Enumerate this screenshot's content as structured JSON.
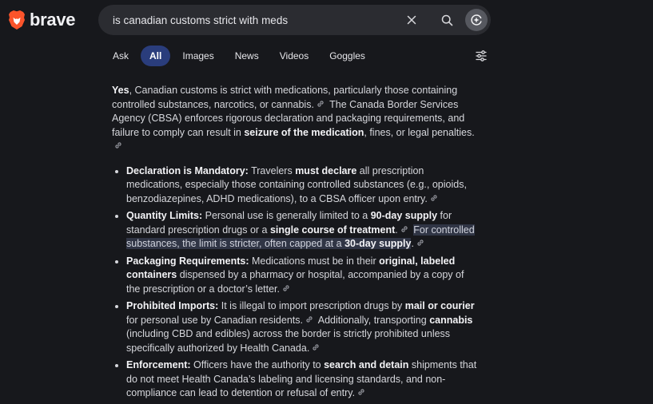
{
  "brand": {
    "name": "brave",
    "logo_color": "#fb542b"
  },
  "search": {
    "query": "is canadian customs strict with meds"
  },
  "tabs": [
    {
      "label": "Ask",
      "active": false
    },
    {
      "label": "All",
      "active": true
    },
    {
      "label": "Images",
      "active": false
    },
    {
      "label": "News",
      "active": false
    },
    {
      "label": "Videos",
      "active": false
    },
    {
      "label": "Goggles",
      "active": false
    }
  ],
  "answer": {
    "intro": {
      "lead": "Yes",
      "t1": ", Canadian customs is strict with medications, particularly those containing controlled substances, narcotics, or cannabis.",
      "t2": " The Canada Border Services Agency (CBSA) enforces rigorous declaration and packaging requirements, and failure to comply can result in ",
      "b1": "seizure of the medication",
      "t3": ", fines, or legal penalties."
    },
    "bullets": [
      {
        "title": "Declaration is Mandatory:",
        "t1": " Travelers ",
        "b1": "must declare",
        "t2": " all prescription medications, especially those containing controlled substances (e.g., opioids, benzodiazepines, ADHD medications), to a CBSA officer upon entry."
      },
      {
        "title": "Quantity Limits:",
        "t1": " Personal use is generally limited to a ",
        "b1": "90-day supply",
        "t2": " for standard prescription drugs or a ",
        "b2": "single course of treatment",
        "t3": ".",
        "h1": "For controlled substances, the limit is stricter, often capped at a ",
        "hb": "30-day supply",
        "h2": "."
      },
      {
        "title": "Packaging Requirements:",
        "t1": " Medications must be in their ",
        "b1": "original, labeled containers",
        "t2": " dispensed by a pharmacy or hospital, accompanied by a copy of the prescription or a doctor’s letter."
      },
      {
        "title": "Prohibited Imports:",
        "t1": " It is illegal to import prescription drugs by ",
        "b1": "mail or courier",
        "t2": " for personal use by Canadian residents.",
        "t3": " Additionally, transporting ",
        "b2": "cannabis",
        "t4": " (including CBD and edibles) across the border is strictly prohibited unless specifically authorized by Health Canada."
      },
      {
        "title": "Enforcement:",
        "t1": " Officers have the authority to ",
        "b1": "search and detain",
        "t2": " shipments that do not meet Health Canada’s labeling and licensing standards, and non-compliance can lead to detention or refusal of entry."
      }
    ]
  },
  "icons": {
    "logo": "brave-lion-icon",
    "clear": "close-icon",
    "search": "search-icon",
    "ai": "ai-sparkle-icon",
    "filter": "sliders-icon",
    "citation": "link-icon"
  }
}
